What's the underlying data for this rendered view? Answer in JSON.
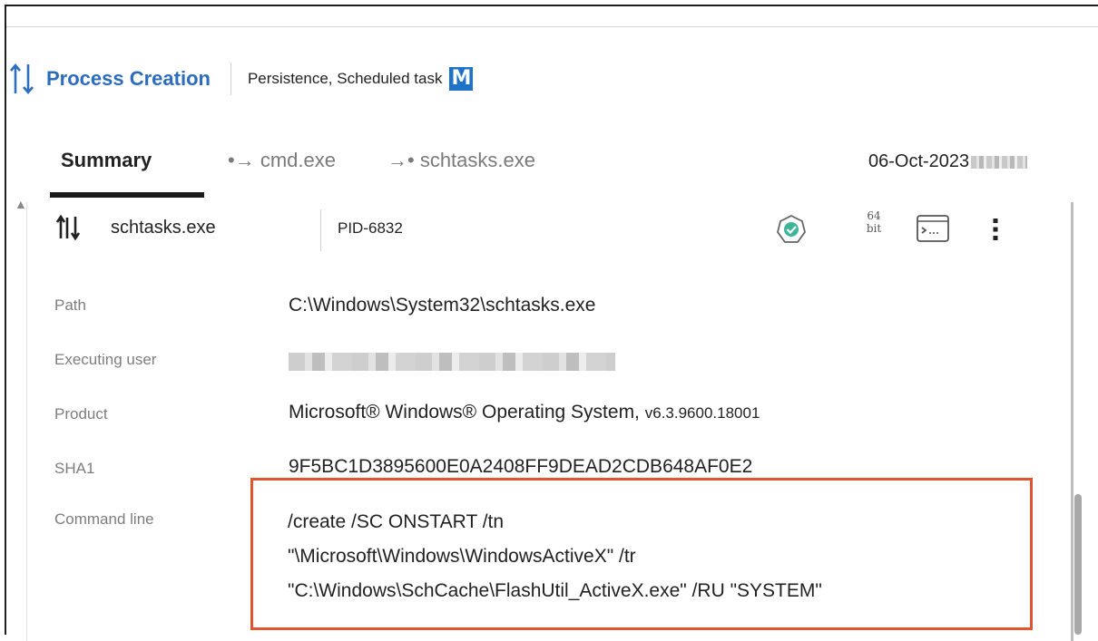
{
  "header": {
    "title": "Process Creation",
    "tags": "Persistence, Scheduled task",
    "badge": "M"
  },
  "tabs": [
    {
      "label": "Summary",
      "active": true
    },
    {
      "label": "•→ cmd.exe",
      "active": false
    },
    {
      "label": "→• schtasks.exe",
      "active": false
    }
  ],
  "timestamp": "06-Oct-2023",
  "process": {
    "name": "schtasks.exe",
    "pid": "PID-6832",
    "bits_top": "64",
    "bits_bottom": "bit"
  },
  "fields": {
    "path_label": "Path",
    "path_value": "C:\\Windows\\System32\\schtasks.exe",
    "user_label": "Executing user",
    "product_label": "Product",
    "product_value": "Microsoft® Windows® Operating System,",
    "product_version": "v6.3.9600.18001",
    "sha1_label": "SHA1",
    "sha1_value": "9F5BC1D3895600E0A2408FF9DEAD2CDB648AF0E2",
    "cmdline_label": "Command line",
    "cmdline_lines": [
      "/create /SC ONSTART /tn",
      "\"\\Microsoft\\Windows\\WindowsActiveX\" /tr",
      "\"C:\\Windows\\SchCache\\FlashUtil_ActiveX.exe\" /RU \"SYSTEM\""
    ]
  },
  "colors": {
    "accent": "#2c6cbc",
    "highlight_box": "#e0542e",
    "mitre_badge": "#1e73c8"
  }
}
